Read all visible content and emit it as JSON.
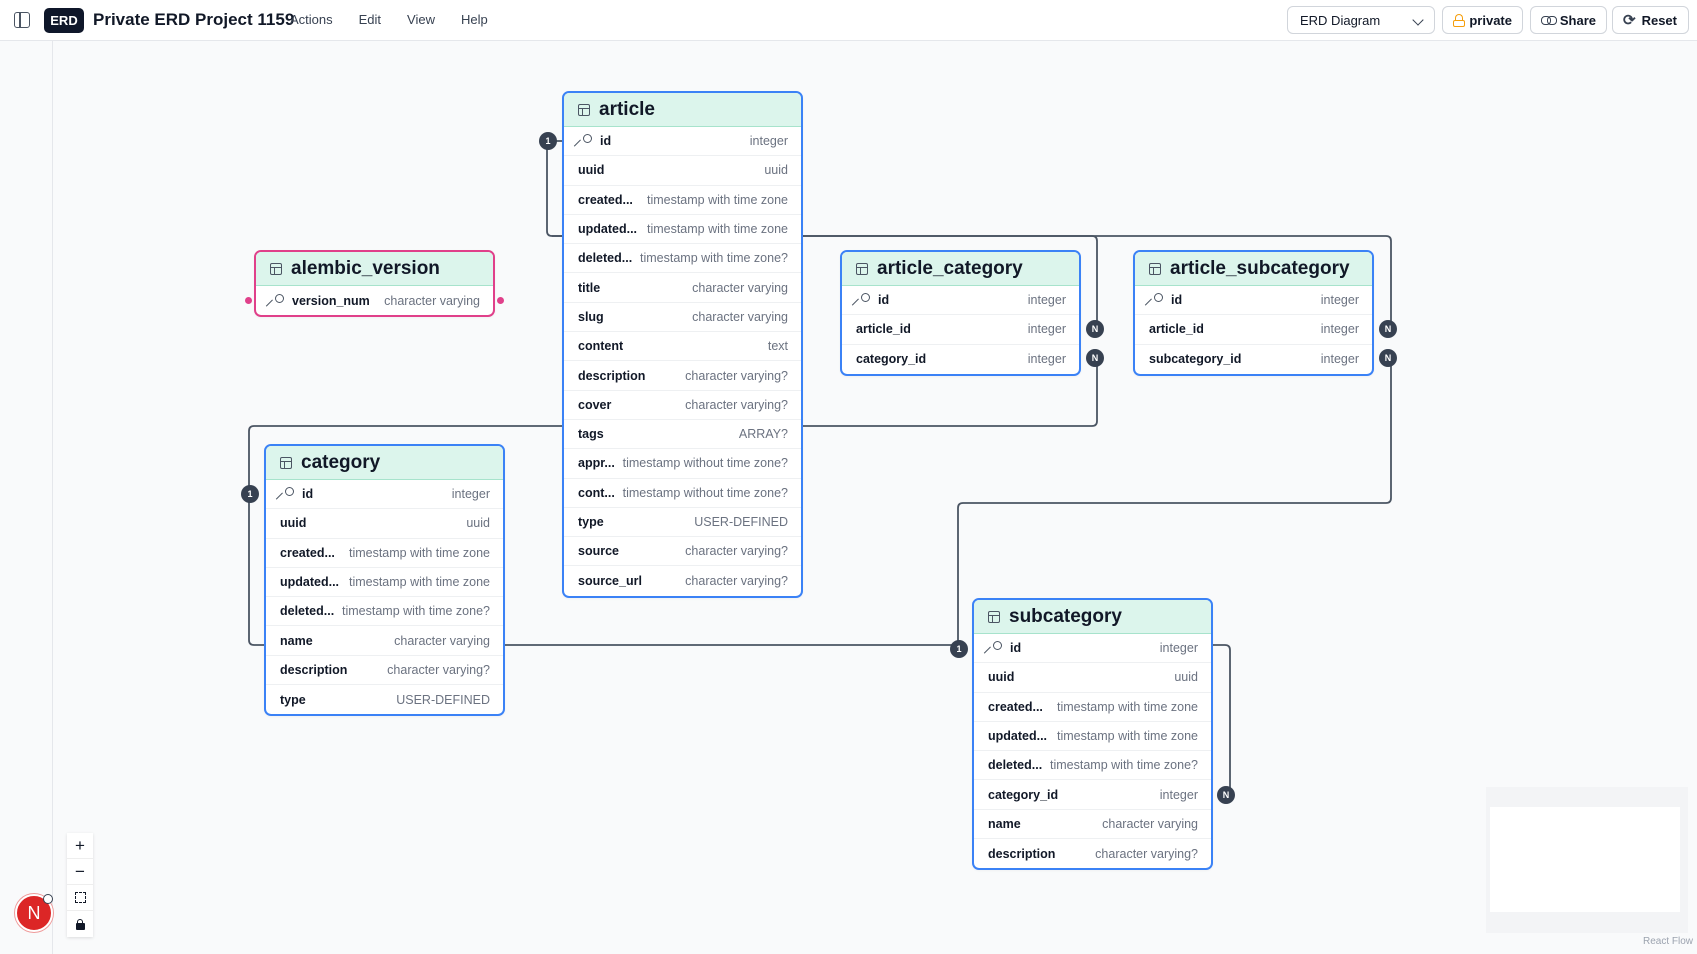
{
  "topbar": {
    "app_badge": "ERD",
    "project_title": "Private ERD Project 1159",
    "menu": [
      "Actions",
      "Edit",
      "View",
      "Help"
    ],
    "diagram_select": "ERD Diagram",
    "private_label": "private",
    "share_label": "Share",
    "reset_label": "Reset"
  },
  "tables": {
    "article": {
      "name": "article",
      "columns": [
        {
          "name": "id",
          "type": "integer",
          "pk": true
        },
        {
          "name": "uuid",
          "type": "uuid"
        },
        {
          "name": "created...",
          "type": "timestamp with time zone"
        },
        {
          "name": "updated...",
          "type": "timestamp with time zone"
        },
        {
          "name": "deleted...",
          "type": "timestamp with time zone?"
        },
        {
          "name": "title",
          "type": "character varying"
        },
        {
          "name": "slug",
          "type": "character varying"
        },
        {
          "name": "content",
          "type": "text"
        },
        {
          "name": "description",
          "type": "character varying?"
        },
        {
          "name": "cover",
          "type": "character varying?"
        },
        {
          "name": "tags",
          "type": "ARRAY?"
        },
        {
          "name": "appr...",
          "type": "timestamp without time zone?"
        },
        {
          "name": "cont...",
          "type": "timestamp without time zone?"
        },
        {
          "name": "type",
          "type": "USER-DEFINED"
        },
        {
          "name": "source",
          "type": "character varying?"
        },
        {
          "name": "source_url",
          "type": "character varying?"
        }
      ]
    },
    "alembic_version": {
      "name": "alembic_version",
      "columns": [
        {
          "name": "version_num",
          "type": "character varying",
          "pk": true
        }
      ]
    },
    "article_category": {
      "name": "article_category",
      "columns": [
        {
          "name": "id",
          "type": "integer",
          "pk": true
        },
        {
          "name": "article_id",
          "type": "integer"
        },
        {
          "name": "category_id",
          "type": "integer"
        }
      ]
    },
    "article_subcategory": {
      "name": "article_subcategory",
      "columns": [
        {
          "name": "id",
          "type": "integer",
          "pk": true
        },
        {
          "name": "article_id",
          "type": "integer"
        },
        {
          "name": "subcategory_id",
          "type": "integer"
        }
      ]
    },
    "category": {
      "name": "category",
      "columns": [
        {
          "name": "id",
          "type": "integer",
          "pk": true
        },
        {
          "name": "uuid",
          "type": "uuid"
        },
        {
          "name": "created...",
          "type": "timestamp with time zone"
        },
        {
          "name": "updated...",
          "type": "timestamp with time zone"
        },
        {
          "name": "deleted...",
          "type": "timestamp with time zone?"
        },
        {
          "name": "name",
          "type": "character varying"
        },
        {
          "name": "description",
          "type": "character varying?"
        },
        {
          "name": "type",
          "type": "USER-DEFINED"
        }
      ]
    },
    "subcategory": {
      "name": "subcategory",
      "columns": [
        {
          "name": "id",
          "type": "integer",
          "pk": true
        },
        {
          "name": "uuid",
          "type": "uuid"
        },
        {
          "name": "created...",
          "type": "timestamp with time zone"
        },
        {
          "name": "updated...",
          "type": "timestamp with time zone"
        },
        {
          "name": "deleted...",
          "type": "timestamp with time zone?"
        },
        {
          "name": "category_id",
          "type": "integer"
        },
        {
          "name": "name",
          "type": "character varying"
        },
        {
          "name": "description",
          "type": "character varying?"
        }
      ]
    }
  },
  "badges": {
    "one": "1",
    "many": "N"
  },
  "controls": {
    "zoom_in": "+",
    "zoom_out": "−"
  },
  "avatar_initial": "N",
  "attribution": "React Flow",
  "colors": {
    "table_border": "#3b82f6",
    "header_bg": "#dcf5ec",
    "highlight": "#e0408a",
    "edge": "#4b5563"
  }
}
